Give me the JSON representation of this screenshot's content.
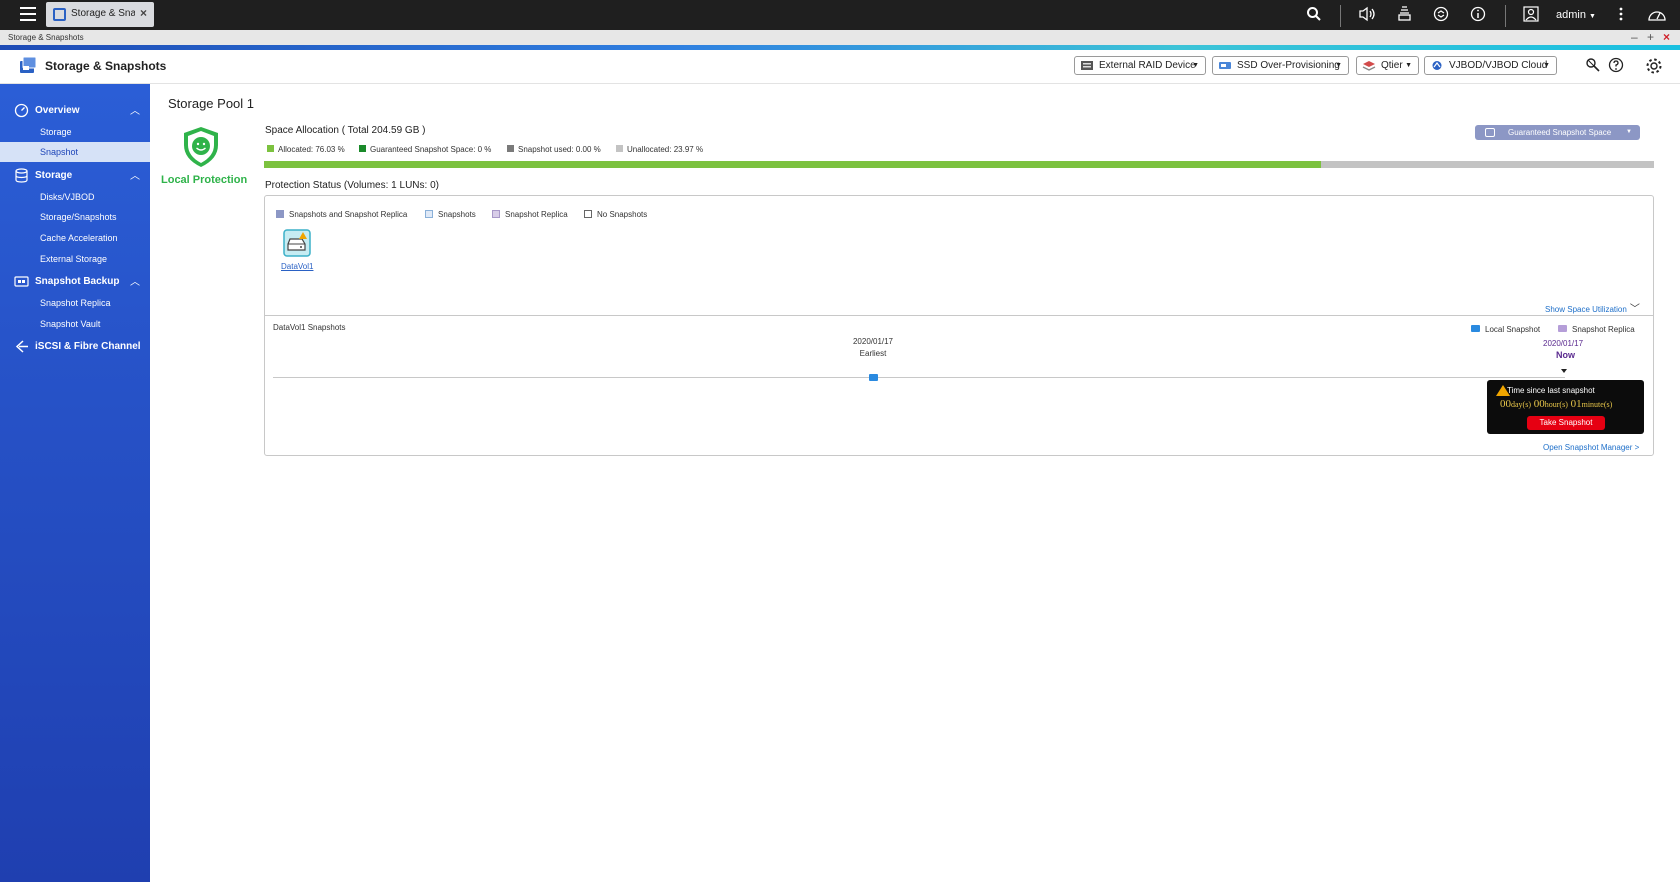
{
  "topbar": {
    "active_app_tab": "Storage & Sna...",
    "user": "admin",
    "icons": [
      "menu-icon",
      "search-icon",
      "volume-icon",
      "stack-icon",
      "sync-icon",
      "info-icon",
      "user-icon",
      "more-icon",
      "dashboard-icon"
    ]
  },
  "window": {
    "title": "Storage & Snapshots",
    "controls": [
      "minimize",
      "maximize",
      "close"
    ]
  },
  "app_header": {
    "title": "Storage & Snapshots",
    "buttons": {
      "external_raid": "External RAID Device",
      "ssd_op": "SSD Over-Provisioning",
      "qtier": "Qtier",
      "vjbod": "VJBOD/VJBOD Cloud"
    }
  },
  "sidebar": {
    "overview": "Overview",
    "overview_items": [
      "Storage",
      "Snapshot"
    ],
    "storage": "Storage",
    "storage_items": [
      "Disks/VJBOD",
      "Storage/Snapshots",
      "Cache Acceleration",
      "External Storage"
    ],
    "snapshot_backup": "Snapshot Backup",
    "snapshot_backup_items": [
      "Snapshot Replica",
      "Snapshot Vault"
    ],
    "iscsi": "iSCSI & Fibre Channel",
    "active_item": "Snapshot"
  },
  "main": {
    "pool_title": "Storage Pool 1",
    "local_protection": "Local Protection",
    "space_allocation_title": "Space Allocation ( Total 204.59 GB )",
    "allocation_legend": {
      "allocated": "Allocated: 76.03 %",
      "guaranteed": "Guaranteed Snapshot Space: 0 %",
      "snapshot_used": "Snapshot used: 0.00 %",
      "unallocated": "Unallocated: 23.97 %"
    },
    "allocated_percent": 76.03,
    "guaranteed_button": "Guaranteed Snapshot Space",
    "protection_title": "Protection Status (Volumes: 1 LUNs: 0)",
    "protection_legend": {
      "both": "Snapshots and Snapshot Replica",
      "snapshots": "Snapshots",
      "replica": "Snapshot Replica",
      "none": "No Snapshots"
    },
    "volume_label": "DataVol1",
    "show_space_util": "Show Space Utilization",
    "snapshots_title": "DataVol1 Snapshots",
    "timeline_legend": {
      "local": "Local Snapshot",
      "replica": "Snapshot Replica"
    },
    "earliest_date": "2020/01/17",
    "earliest_label": "Earliest",
    "now_date": "2020/01/17",
    "now_label": "Now",
    "tooltip": {
      "title": "Time since last snapshot",
      "days": "00",
      "days_unit": "day(s)",
      "hours": "00",
      "hours_unit": "hour(s)",
      "minutes": "01",
      "minutes_unit": "minute(s)",
      "button": "Take Snapshot"
    },
    "open_manager": "Open Snapshot Manager >"
  },
  "colors": {
    "allocated": "#7cc23f",
    "guaranteed": "#1a8a2a",
    "snapshot_used": "#7a7a7a",
    "unallocated": "#c3c3c3",
    "sidebar": "#2b5ed6",
    "take_snapshot": "#e60012"
  }
}
